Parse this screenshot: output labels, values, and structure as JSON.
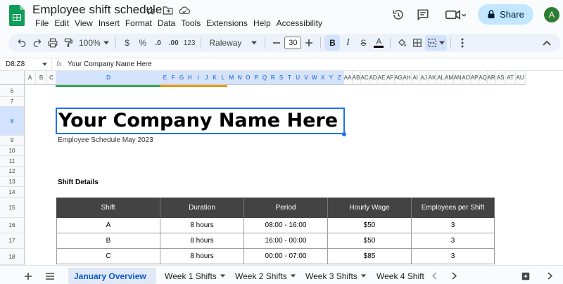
{
  "doc": {
    "title": "Employee shift schedule",
    "menu": [
      "File",
      "Edit",
      "View",
      "Insert",
      "Format",
      "Data",
      "Tools",
      "Extensions",
      "Help",
      "Accessibility"
    ],
    "share_label": "Share",
    "avatar_letter": "A"
  },
  "toolbar": {
    "zoom": "100%",
    "currency": "$",
    "percent": "%",
    "dec_decrease": ".0",
    "dec_increase": ".00",
    "number_format": "123",
    "font": "Raleway",
    "font_size": "30",
    "bold": "B",
    "italic": "I",
    "strike": "S",
    "text_color": "A"
  },
  "formula": {
    "range": "D8:Z8",
    "content": "Your Company Name Here"
  },
  "columns": [
    "A",
    "B",
    "C",
    "D",
    "E",
    "F",
    "G",
    "H",
    "I",
    "J",
    "K",
    "L",
    "M",
    "N",
    "O",
    "P",
    "Q",
    "R",
    "S",
    "T",
    "U",
    "V",
    "W",
    "X",
    "Y",
    "Z",
    "AA",
    "AB",
    "AC",
    "AD",
    "AE",
    "AF",
    "AG",
    "AH",
    "AI",
    "AJ",
    "AK",
    "AL",
    "AM",
    "AN",
    "AO",
    "AP",
    "AQ",
    "AR",
    "AS",
    "AT",
    "AU"
  ],
  "rows": [
    "6",
    "7",
    "8",
    "9",
    "10",
    "11",
    "12",
    "13",
    "14",
    "15",
    "16",
    "17",
    "18"
  ],
  "sheet": {
    "company_name": "Your Company Name Here",
    "subtitle": "Employee Schedule May 2023",
    "section_title": "Shift Details",
    "table_headers": [
      "Shift",
      "Duration",
      "Period",
      "Hourly Wage",
      "Employees per Shift"
    ],
    "table_rows": [
      [
        "A",
        "8 hours",
        "08:00 - 16:00",
        "$50",
        "3"
      ],
      [
        "B",
        "8 hours",
        "16:00 - 00:00",
        "$50",
        "3"
      ],
      [
        "C",
        "8 hours",
        "00:00 - 07:00",
        "$85",
        "3"
      ]
    ]
  },
  "tabs": [
    "January Overview",
    "Week 1 Shifts",
    "Week 2 Shifts",
    "Week 3 Shifts",
    "Week 4 Shift"
  ],
  "colors": {
    "accent": "#1a73e8",
    "band_green": "#34a853",
    "band_orange": "#f29900",
    "header_dark": "#434343"
  }
}
